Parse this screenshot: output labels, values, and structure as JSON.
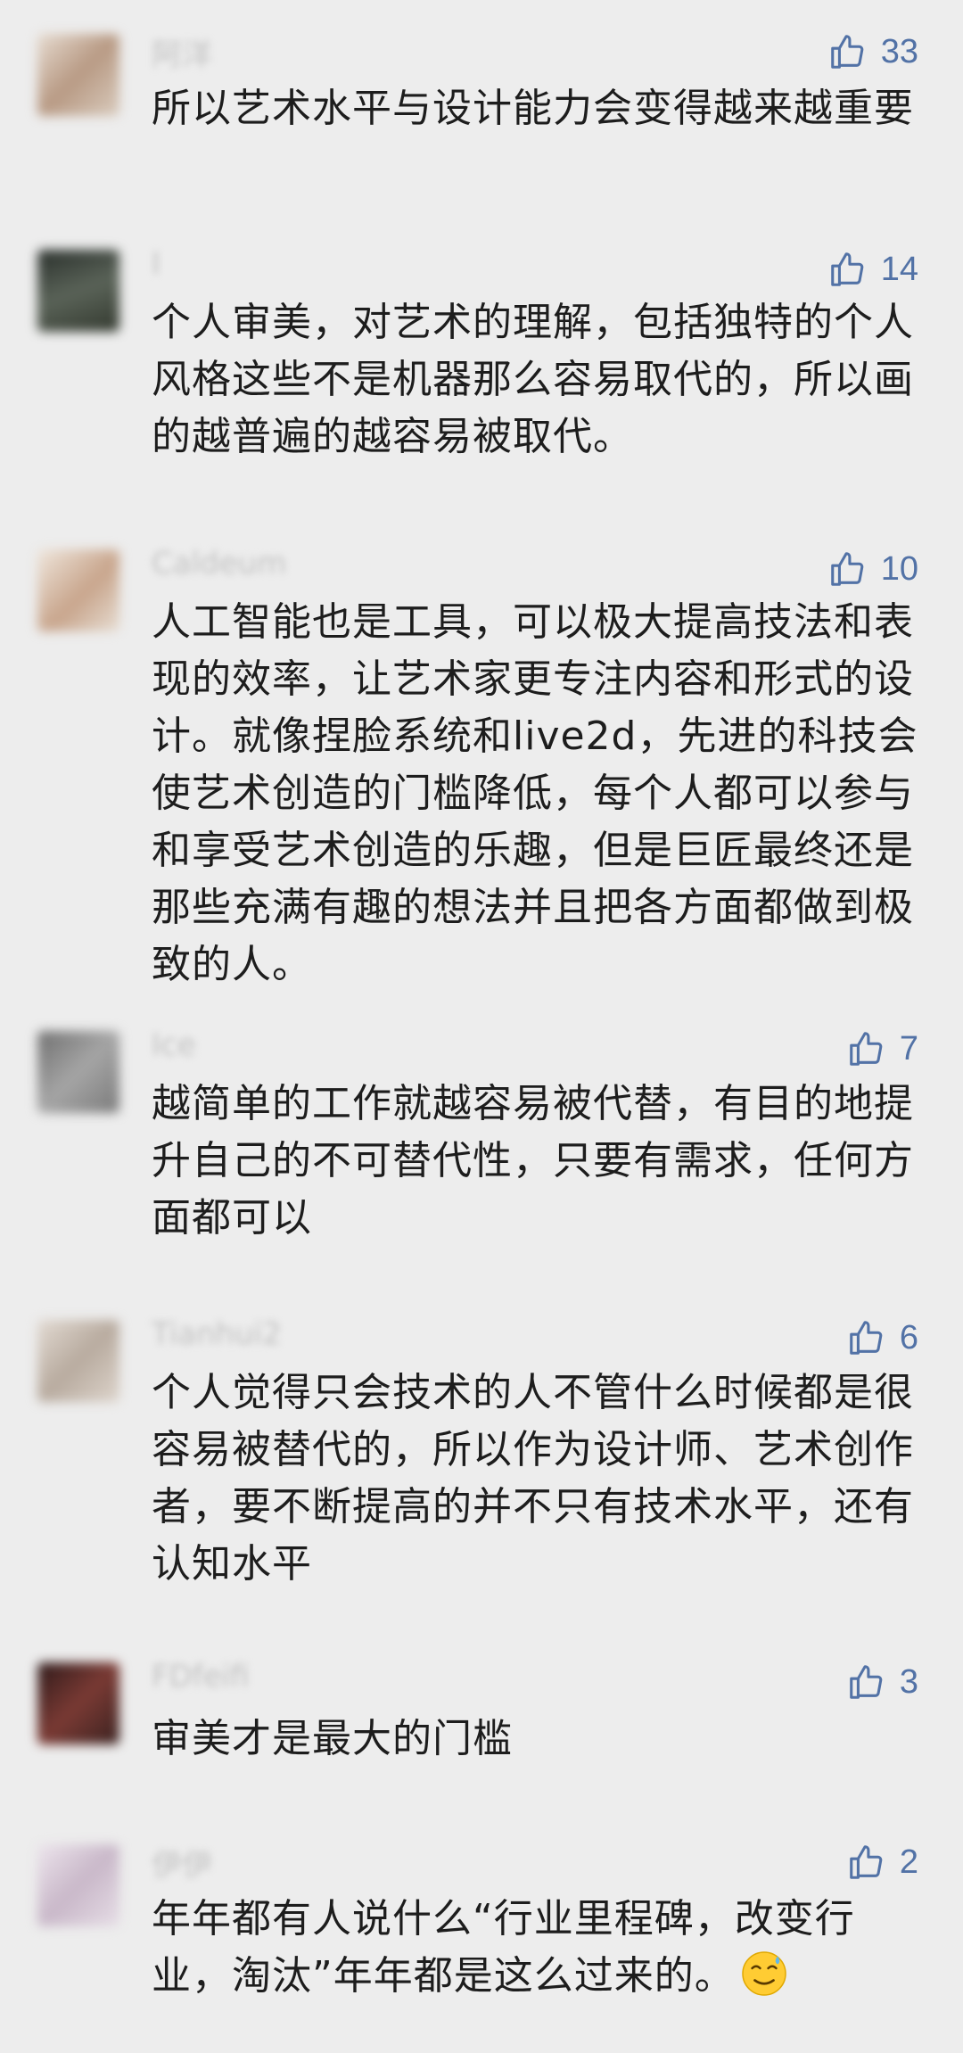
{
  "comments": [
    {
      "username": "阿洋",
      "likes": "33",
      "text": "所以艺术水平与设计能力会变得越来越重要",
      "avatar_color": "#c9b8a6"
    },
    {
      "username": "I",
      "likes": "14",
      "text": "个人审美，对艺术的理解，包括独特的个人风格这些不是机器那么容易取代的，所以画的越普遍的越容易被取代。",
      "avatar_color": "#3f4540"
    },
    {
      "username": "Caldeum",
      "likes": "10",
      "text": "人工智能也是工具，可以极大提高技法和表现的效率，让艺术家更专注内容和形式的设计。就像捏脸系统和live2d，先进的科技会使艺术创造的门槛降低，每个人都可以参与和享受艺术创造的乐趣，但是巨匠最终还是那些充满有趣的想法并且把各方面都做到极致的人。",
      "avatar_color": "#d8c8b8"
    },
    {
      "username": "Ice",
      "likes": "7",
      "text": "越简单的工作就越容易被代替，有目的地提升自己的不可替代性，只要有需求，任何方面都可以",
      "avatar_color": "#8a8a8a"
    },
    {
      "username": "Tianhui2",
      "likes": "6",
      "text": "个人觉得只会技术的人不管什么时候都是很容易被替代的，所以作为设计师、艺术创作者，要不断提高的并不只有技术水平，还有认知水平",
      "avatar_color": "#cfc6bd"
    },
    {
      "username": "FDfeifi",
      "likes": "3",
      "text": "审美才是最大的门槛",
      "avatar_color": "#4a2a28"
    },
    {
      "username": "伊伊",
      "likes": "2",
      "text": "年年都有人说什么“行业里程碑，改变行业，淘汰”年年都是这么过来的。",
      "avatar_color": "#d6ccd6",
      "emoji": "sweat-smile-emoji"
    }
  ],
  "colors": {
    "background": "#ededed",
    "like_blue": "#5272a6",
    "text": "#1d1d1d",
    "username": "#c2c2c2"
  }
}
